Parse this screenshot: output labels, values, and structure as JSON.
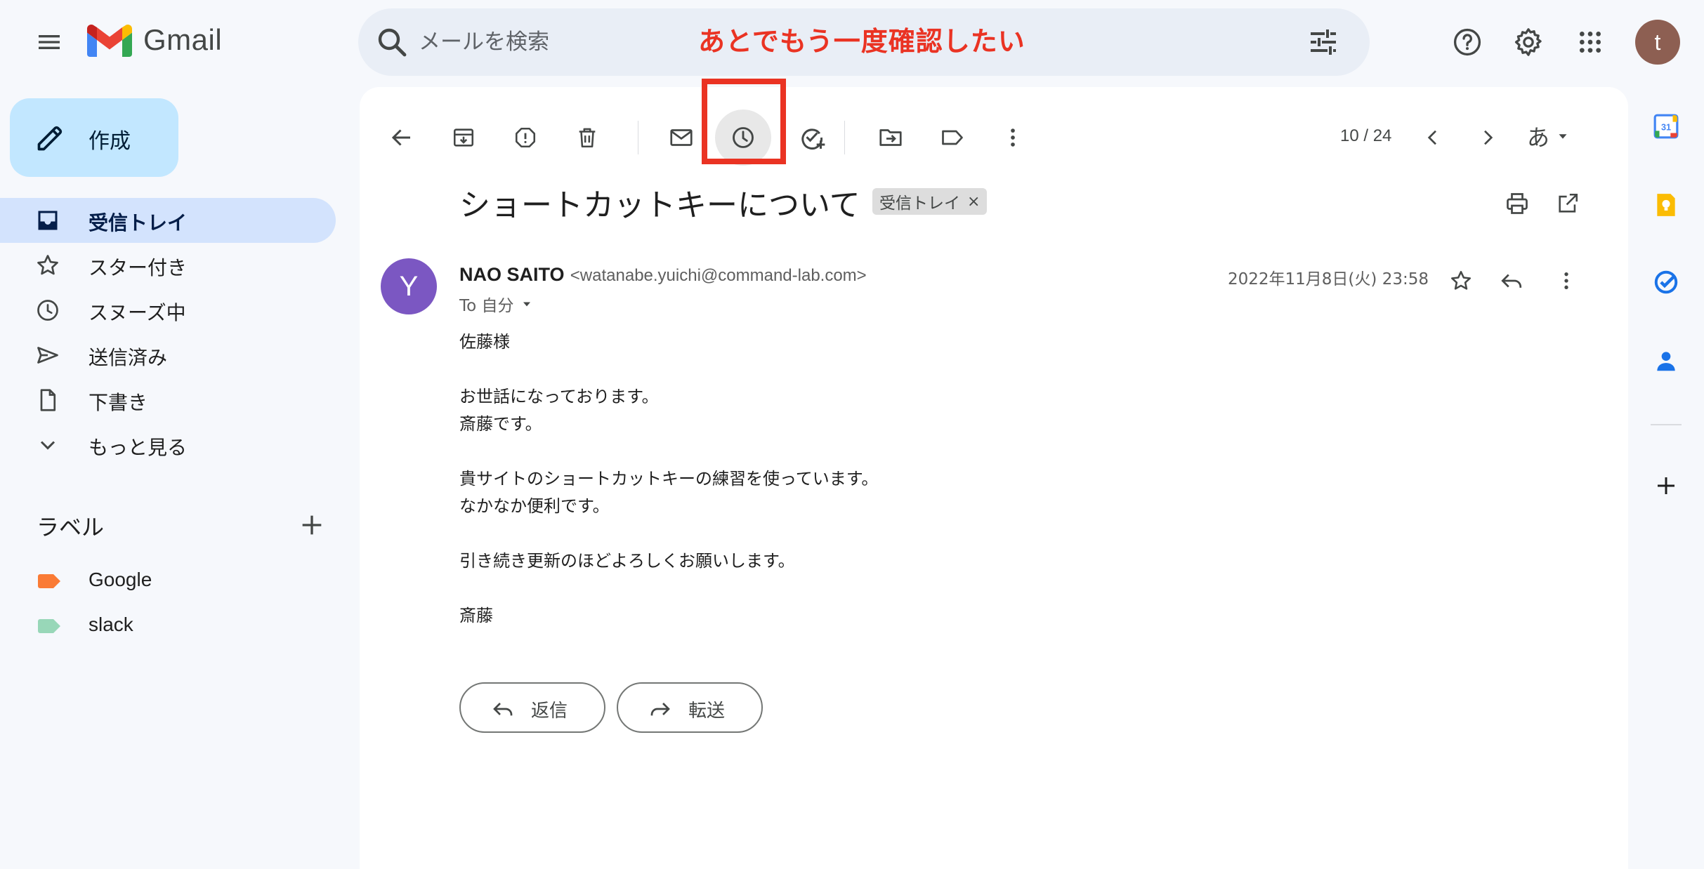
{
  "app": {
    "name": "Gmail"
  },
  "search": {
    "placeholder": "メールを検索"
  },
  "annotation": {
    "text": "あとでもう一度確認したい"
  },
  "compose": {
    "label": "作成"
  },
  "nav": {
    "items": [
      {
        "label": "受信トレイ",
        "icon": "inbox-icon",
        "active": true
      },
      {
        "label": "スター付き",
        "icon": "star-icon"
      },
      {
        "label": "スヌーズ中",
        "icon": "clock-icon"
      },
      {
        "label": "送信済み",
        "icon": "send-icon"
      },
      {
        "label": "下書き",
        "icon": "draft-icon"
      },
      {
        "label": "もっと見る",
        "icon": "chevron-down-icon"
      }
    ]
  },
  "labels": {
    "heading": "ラベル",
    "items": [
      {
        "label": "Google",
        "color": "#fa7b35"
      },
      {
        "label": "slack",
        "color": "#98d7b8"
      }
    ]
  },
  "toolbar": {
    "pager": "10 / 24",
    "input_tool": "あ"
  },
  "email": {
    "subject": "ショートカットキーについて",
    "chip": "受信トレイ",
    "chip_close": "×",
    "sender_initial": "Y",
    "sender_name": "NAO SAITO",
    "sender_email": "<watanabe.yuichi@command-lab.com>",
    "to": "To 自分",
    "date": "2022年11月8日(火) 23:58",
    "body": [
      "佐藤様",
      "",
      "お世話になっております。",
      "斎藤です。",
      "",
      "貴サイトのショートカットキーの練習を使っています。",
      "なかなか便利です。",
      "",
      "引き続き更新のほどよろしくお願いします。",
      "",
      "斎藤"
    ],
    "reply_label": "返信",
    "forward_label": "転送"
  },
  "user": {
    "initial": "t"
  },
  "colors": {
    "accent_blue": "#c2e7ff",
    "nav_active": "#d3e3fd",
    "annotation_red": "#ea3323",
    "sender_avatar": "#7b57c2",
    "user_avatar": "#8d5f52"
  }
}
